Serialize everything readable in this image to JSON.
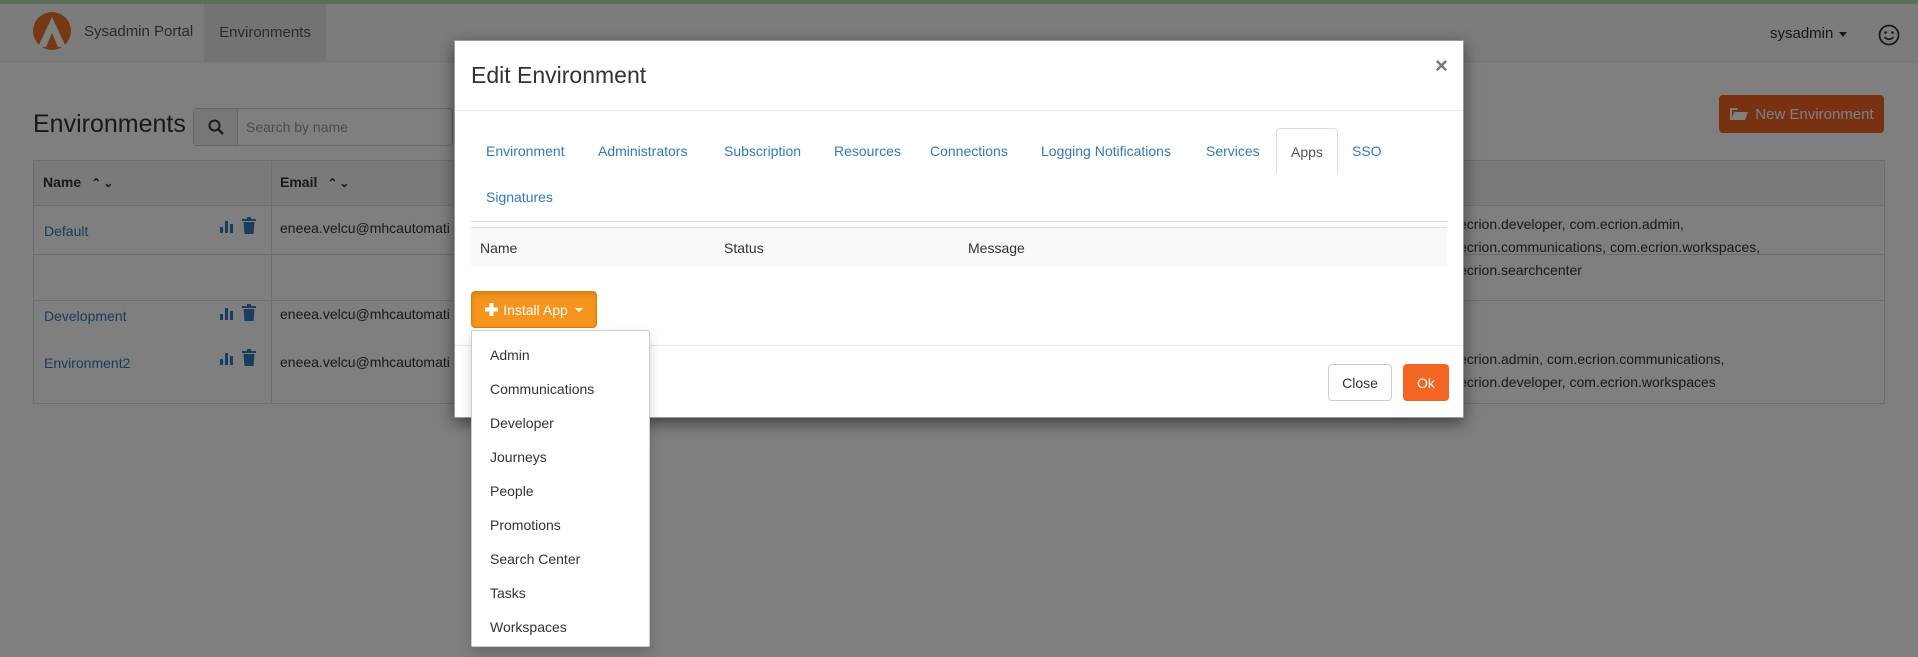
{
  "navbar": {
    "brand": "Sysadmin Portal",
    "active_tab": "Environments",
    "user": "sysadmin"
  },
  "page": {
    "title": "Environments",
    "search_placeholder": "Search by name",
    "new_button": "New Environment"
  },
  "table": {
    "headers": {
      "name": "Name",
      "email": "Email"
    },
    "rows": [
      {
        "name": "Default",
        "email": "eneea.velcu@mhcautomati",
        "apps_line1": "ecrion.developer, com.ecrion.admin,",
        "apps_line2": "ecrion.communications, com.ecrion.workspaces,",
        "apps_line3": "ecrion.searchcenter"
      },
      {
        "name": "Development",
        "email": "eneea.velcu@mhcautomati",
        "apps_line1": "",
        "apps_line2": "",
        "apps_line3": ""
      },
      {
        "name": "Environment2",
        "email": "eneea.velcu@mhcautomati",
        "apps_line1": "ecrion.admin, com.ecrion.communications,",
        "apps_line2": "ecrion.developer, com.ecrion.workspaces",
        "apps_line3": ""
      }
    ]
  },
  "modal": {
    "title": "Edit Environment",
    "close_symbol": "×",
    "tabs": [
      "Environment",
      "Administrators",
      "Subscription",
      "Resources",
      "Connections",
      "Logging Notifications",
      "Services",
      "Apps",
      "SSO",
      "Signatures"
    ],
    "active_tab": "Apps",
    "apps_table": {
      "headers": [
        "Name",
        "Status",
        "Message"
      ]
    },
    "install_button": "Install App",
    "dropdown_items": [
      "Admin",
      "Communications",
      "Developer",
      "Journeys",
      "People",
      "Promotions",
      "Search Center",
      "Tasks",
      "Workspaces"
    ],
    "close_button": "Close",
    "ok_button": "Ok"
  },
  "colors": {
    "accent_orange": "#f26522",
    "install_orange": "#f7941d",
    "link_blue": "#337ab7"
  },
  "icons": {
    "logo": "arrow-logo-icon",
    "user": "smiley-icon",
    "search": "search-icon",
    "folder": "folder-open-icon",
    "stats": "bar-chart-icon",
    "delete": "trash-icon",
    "plus": "plus-icon"
  }
}
